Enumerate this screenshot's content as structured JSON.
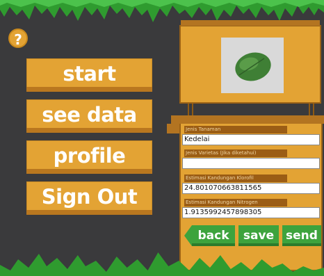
{
  "help": {
    "label": "?"
  },
  "menu": {
    "start": "start",
    "see_data": "see data",
    "profile": "profile",
    "sign_out": "Sign Out"
  },
  "form": {
    "jenis_tanaman": {
      "label": "Jenis Tanaman",
      "value": "Kedelai"
    },
    "jenis_varietas": {
      "label": "Jenis Varietas (Jika diketahui)",
      "value": ""
    },
    "klorofil": {
      "label": "Estimasi Kandungan Klorofil",
      "value": "24.801070663811565"
    },
    "nitrogen": {
      "label": "Estimasi Kandungan Nitrogen",
      "value": "1.9135992457898305"
    }
  },
  "actions": {
    "back": "back",
    "save": "save",
    "send": "send"
  },
  "colors": {
    "background": "#3a3a3c",
    "board": "#e3a334",
    "board_dark": "#b37421",
    "label_bg": "#9b5d15",
    "action_green": "#3da33d",
    "grass": "#2f9b2f"
  }
}
